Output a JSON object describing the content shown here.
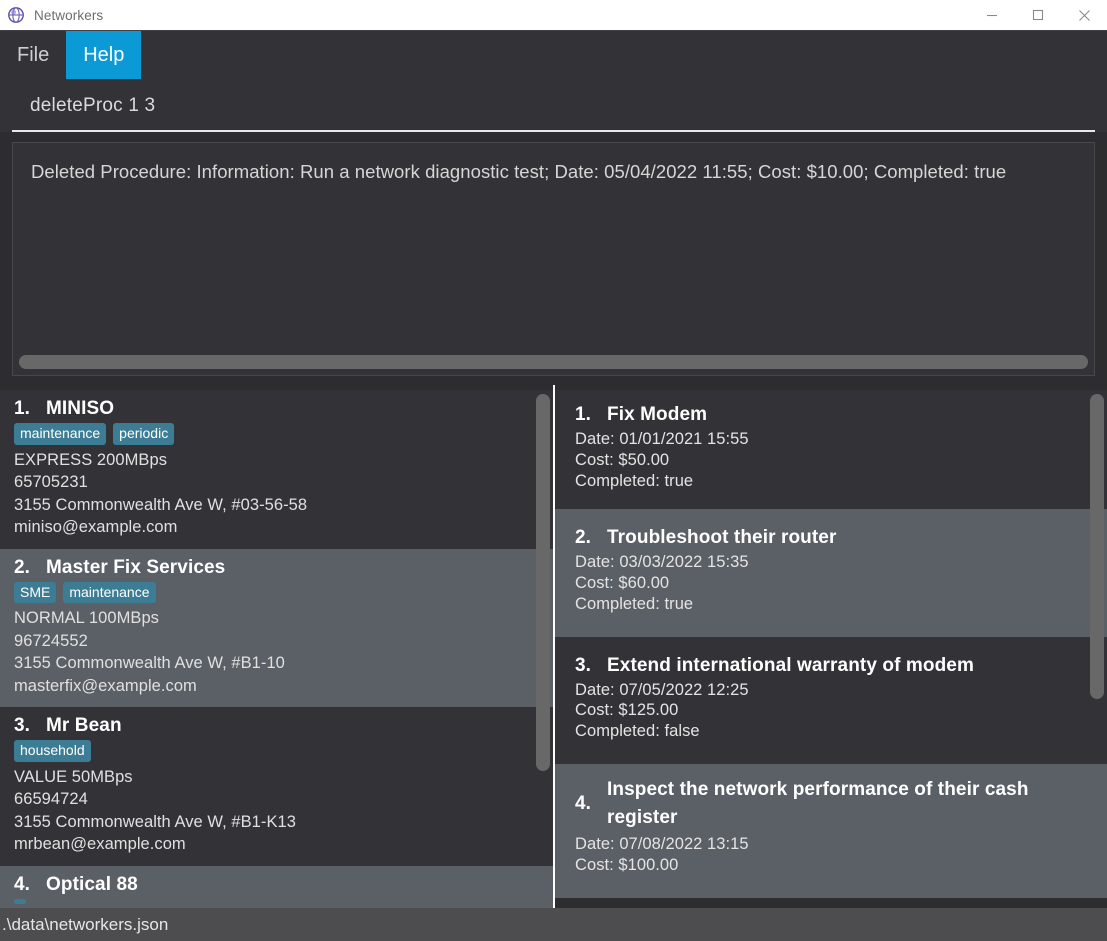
{
  "window": {
    "title": "Networkers",
    "icon": "globe-network-icon",
    "minimize_label": "—",
    "maximize_label": "□",
    "close_label": "✕"
  },
  "menubar": {
    "items": [
      {
        "label": "File",
        "active": false
      },
      {
        "label": "Help",
        "active": true
      }
    ],
    "accent_color": "#0c9ad6"
  },
  "command": {
    "value": "deleteProc 1 3",
    "placeholder": ""
  },
  "output": {
    "text": "Deleted Procedure: Information: Run a network diagnostic test; Date: 05/04/2022 11:55; Cost: $10.00; Completed: true"
  },
  "networkers_panel": {
    "items": [
      {
        "number": "1.",
        "name": "MINISO",
        "tags": [
          "maintenance",
          "periodic"
        ],
        "plan": "EXPRESS 200MBps",
        "phone": "65705231",
        "address": "3155 Commonwealth Ave W, #03-56-58",
        "email": "miniso@example.com",
        "shade": "dark"
      },
      {
        "number": "2.",
        "name": "Master Fix Services",
        "tags": [
          "SME",
          "maintenance"
        ],
        "plan": "NORMAL 100MBps",
        "phone": "96724552",
        "address": "3155 Commonwealth Ave W, #B1-10",
        "email": "masterfix@example.com",
        "shade": "light"
      },
      {
        "number": "3.",
        "name": "Mr Bean",
        "tags": [
          "household"
        ],
        "plan": "VALUE 50MBps",
        "phone": "66594724",
        "address": "3155 Commonwealth Ave W, #B1-K13",
        "email": "mrbean@example.com",
        "shade": "dark"
      },
      {
        "number": "4.",
        "name": "Optical 88",
        "tags": [
          ""
        ],
        "plan": "",
        "phone": "",
        "address": "",
        "email": "",
        "shade": "light"
      }
    ]
  },
  "procedures_panel": {
    "items": [
      {
        "number": "1.",
        "title": "Fix Modem",
        "date": "Date: 01/01/2021 15:55",
        "cost": "Cost: $50.00",
        "completed": "Completed: true",
        "shade": "dark"
      },
      {
        "number": "2.",
        "title": "Troubleshoot their router",
        "date": "Date: 03/03/2022 15:35",
        "cost": "Cost: $60.00",
        "completed": "Completed: true",
        "shade": "light"
      },
      {
        "number": "3.",
        "title": "Extend international warranty of modem",
        "date": "Date: 07/05/2022 12:25",
        "cost": "Cost: $125.00",
        "completed": "Completed: false",
        "shade": "dark"
      },
      {
        "number": "4.",
        "title": "Inspect the network performance of their cash register",
        "date": "Date: 07/08/2022 13:15",
        "cost": "Cost: $100.00",
        "completed": "",
        "shade": "light"
      }
    ]
  },
  "statusbar": {
    "path": ".\\data\\networkers.json"
  },
  "colors": {
    "accent": "#0c9ad6",
    "tag": "#3c7d95",
    "row_dark": "#333337",
    "row_light": "#5a6066",
    "app_bg": "#2d2d30"
  }
}
